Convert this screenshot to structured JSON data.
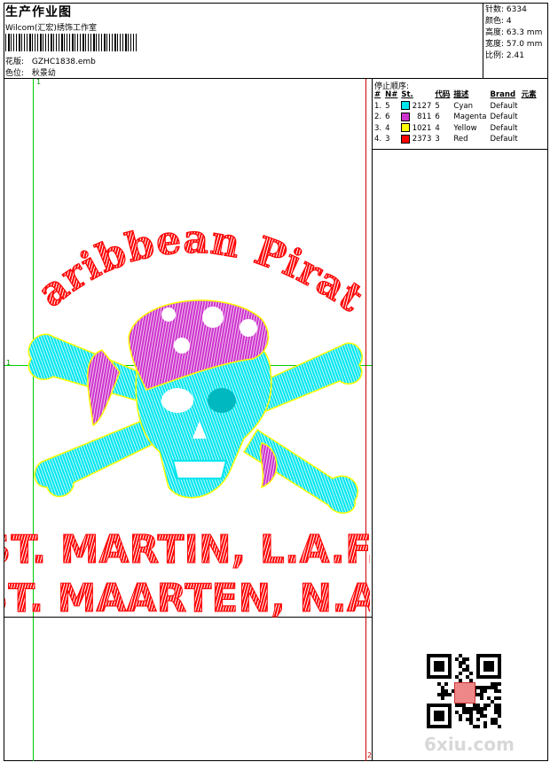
{
  "header": {
    "title": "生产作业图",
    "software": "Wilcom(汇宏)绣饰工作室",
    "design_label": "花版:",
    "design_value": "GZHC1838.emb",
    "colorway_label": "色位:",
    "colorway_value": "秋景幼"
  },
  "stats": [
    {
      "label": "针数:",
      "value": "6334"
    },
    {
      "label": "颜色:",
      "value": "4"
    },
    {
      "label": "高度:",
      "value": "63.3 mm"
    },
    {
      "label": "宽度:",
      "value": "57.0 mm"
    },
    {
      "label": "比例:",
      "value": "2.41"
    }
  ],
  "sequence": {
    "title": "停止顺序:",
    "headers": [
      "#",
      "N#",
      "St.",
      "代码",
      "描述",
      "Brand",
      "元素"
    ],
    "rows": [
      {
        "n": "1.",
        "nn": "5",
        "color": "#00e5ee",
        "st": "2127",
        "code": "5",
        "desc": "Cyan",
        "brand": "Default"
      },
      {
        "n": "2.",
        "nn": "6",
        "color": "#cc33cc",
        "st": "811",
        "code": "6",
        "desc": "Magenta",
        "brand": "Default"
      },
      {
        "n": "3.",
        "nn": "4",
        "color": "#ffff00",
        "st": "1021",
        "code": "4",
        "desc": "Yellow",
        "brand": "Default"
      },
      {
        "n": "4.",
        "nn": "3",
        "color": "#ff0000",
        "st": "2373",
        "code": "3",
        "desc": "Red",
        "brand": "Default"
      }
    ]
  },
  "design": {
    "arc_text": "Caribbean Pirate",
    "line1": "ST. MARTIN, L.A.F.",
    "line2": "ST. MAARTEN, N.A."
  },
  "markers": {
    "top": "1",
    "left": "1",
    "bottom": "2"
  },
  "watermark": "6xiu.com",
  "colors": {
    "cyan": "#00e5ee",
    "magenta": "#cc33cc",
    "yellow": "#ffff00",
    "red": "#ff0000",
    "guide": "#00cc00"
  }
}
